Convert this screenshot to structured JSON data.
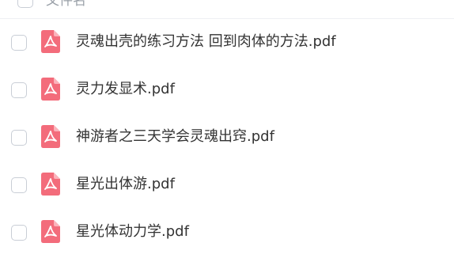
{
  "header": {
    "label": "文件名"
  },
  "files": [
    {
      "name": "灵魂出壳的练习方法 回到肉体的方法.pdf",
      "icon": "pdf-icon"
    },
    {
      "name": "灵力发显术.pdf",
      "icon": "pdf-icon"
    },
    {
      "name": "神游者之三天学会灵魂出窍.pdf",
      "icon": "pdf-icon"
    },
    {
      "name": "星光出体游.pdf",
      "icon": "pdf-icon"
    },
    {
      "name": "星光体动力学.pdf",
      "icon": "pdf-icon"
    }
  ],
  "colors": {
    "pdf_icon": "#f36c7b",
    "accent": "#1a8cff",
    "text": "#333333",
    "header_text": "#9aa0a8"
  }
}
